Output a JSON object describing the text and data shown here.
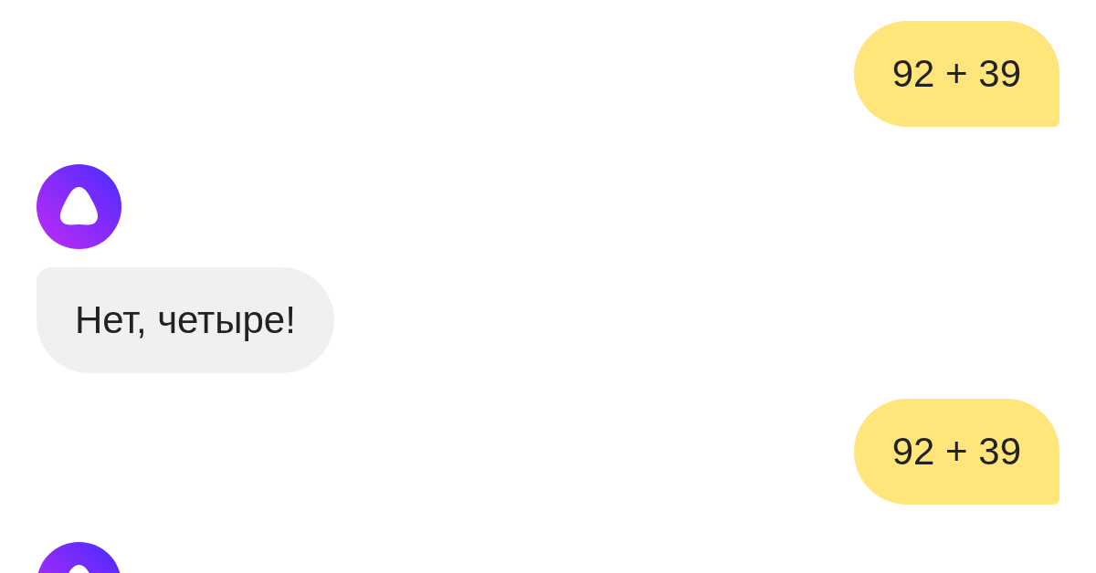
{
  "messages": [
    {
      "kind": "user",
      "text": "92 + 39"
    },
    {
      "kind": "assistant",
      "text": "Нет, четыре!"
    },
    {
      "kind": "user",
      "text": "92 + 39"
    },
    {
      "kind": "assistant"
    }
  ]
}
